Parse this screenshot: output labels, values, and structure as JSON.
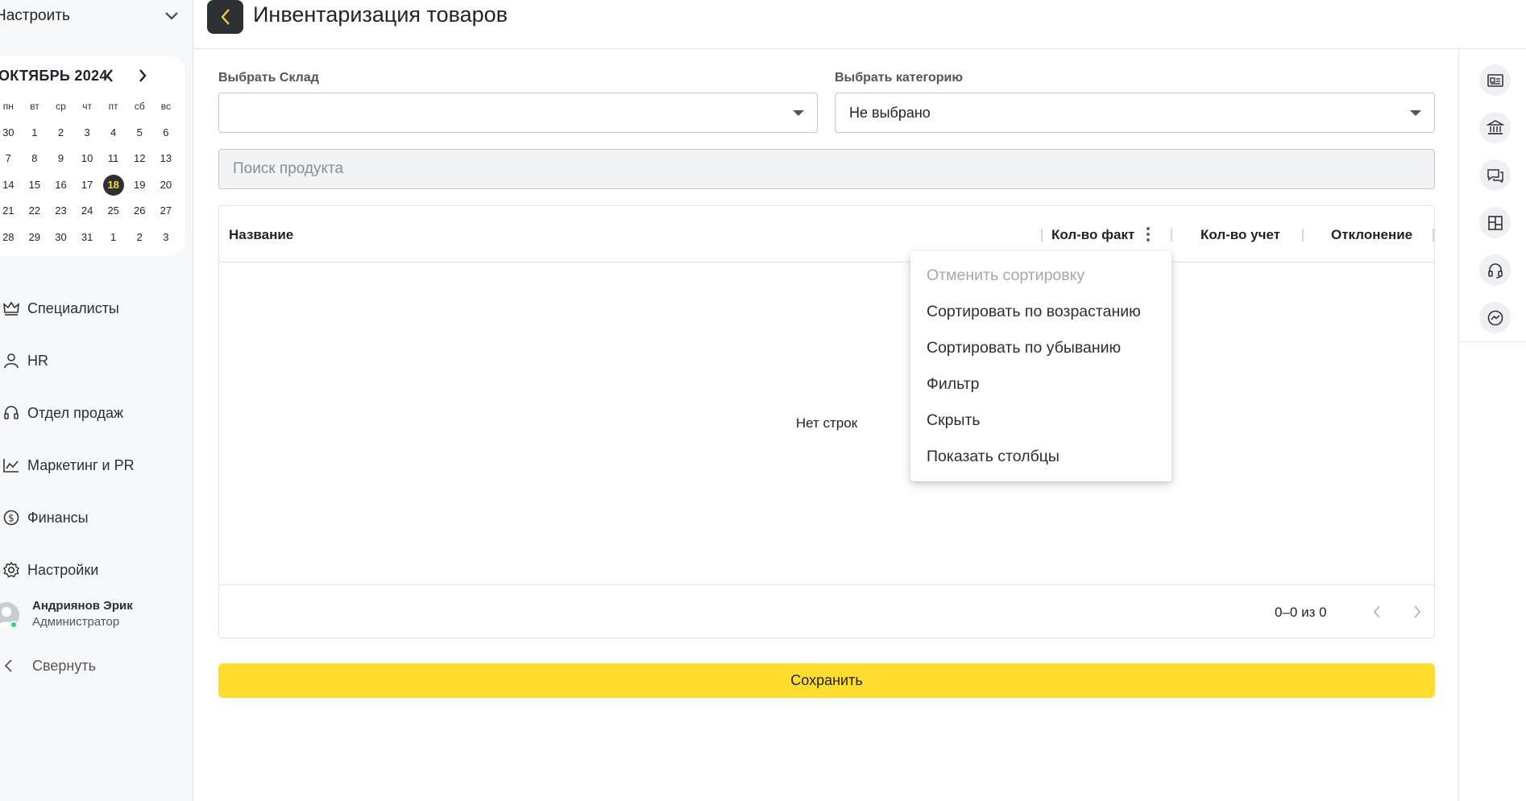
{
  "sidebar": {
    "setup_label": "Настроить",
    "calendar": {
      "month_title": "ОКТЯБРЬ 2024",
      "weekdays": [
        "пн",
        "вт",
        "ср",
        "чт",
        "пт",
        "сб",
        "вс"
      ],
      "weeks": [
        [
          "30",
          "1",
          "2",
          "3",
          "4",
          "5",
          "6"
        ],
        [
          "7",
          "8",
          "9",
          "10",
          "11",
          "12",
          "13"
        ],
        [
          "14",
          "15",
          "16",
          "17",
          "18",
          "19",
          "20"
        ],
        [
          "21",
          "22",
          "23",
          "24",
          "25",
          "26",
          "27"
        ],
        [
          "28",
          "29",
          "30",
          "31",
          "1",
          "2",
          "3"
        ]
      ],
      "today": "18"
    },
    "nav": [
      {
        "label": "Специалисты",
        "icon": "crown-icon"
      },
      {
        "label": "HR",
        "icon": "user-icon"
      },
      {
        "label": "Отдел продаж",
        "icon": "headset-icon"
      },
      {
        "label": "Маркетинг и PR",
        "icon": "chart-line-icon"
      },
      {
        "label": "Финансы",
        "icon": "dollar-circle-icon"
      },
      {
        "label": "Настройки",
        "icon": "gear-icon"
      }
    ],
    "profile": {
      "name": "Андриянов Эрик",
      "role": "Администратор"
    },
    "collapse_label": "Свернуть"
  },
  "header": {
    "title": "Инвентаризация товаров"
  },
  "filters": {
    "warehouse_label": "Выбрать Склад",
    "warehouse_value": "",
    "category_label": "Выбрать категорию",
    "category_value": "Не выбрано",
    "search_placeholder": "Поиск продукта"
  },
  "table": {
    "columns": [
      "Название",
      "Кол-во факт",
      "Кол-во учет",
      "Отклонение"
    ],
    "empty_text": "Нет строк",
    "pagination": "0–0 из 0"
  },
  "column_menu": {
    "items": [
      {
        "label": "Отменить сортировку",
        "disabled": true
      },
      {
        "label": "Сортировать по возрастанию",
        "disabled": false
      },
      {
        "label": "Сортировать по убыванию",
        "disabled": false
      },
      {
        "label": "Фильтр",
        "disabled": false
      },
      {
        "label": "Скрыть",
        "disabled": false
      },
      {
        "label": "Показать столбцы",
        "disabled": false
      }
    ]
  },
  "save_label": "Сохранить",
  "colors": {
    "accent": "#ffdc2e",
    "dark": "#2d3134",
    "online": "#2bd67b"
  },
  "right_rail": [
    "id-card-icon",
    "bank-icon",
    "chat-icon",
    "board-icon",
    "headset-icon",
    "messenger-icon"
  ]
}
